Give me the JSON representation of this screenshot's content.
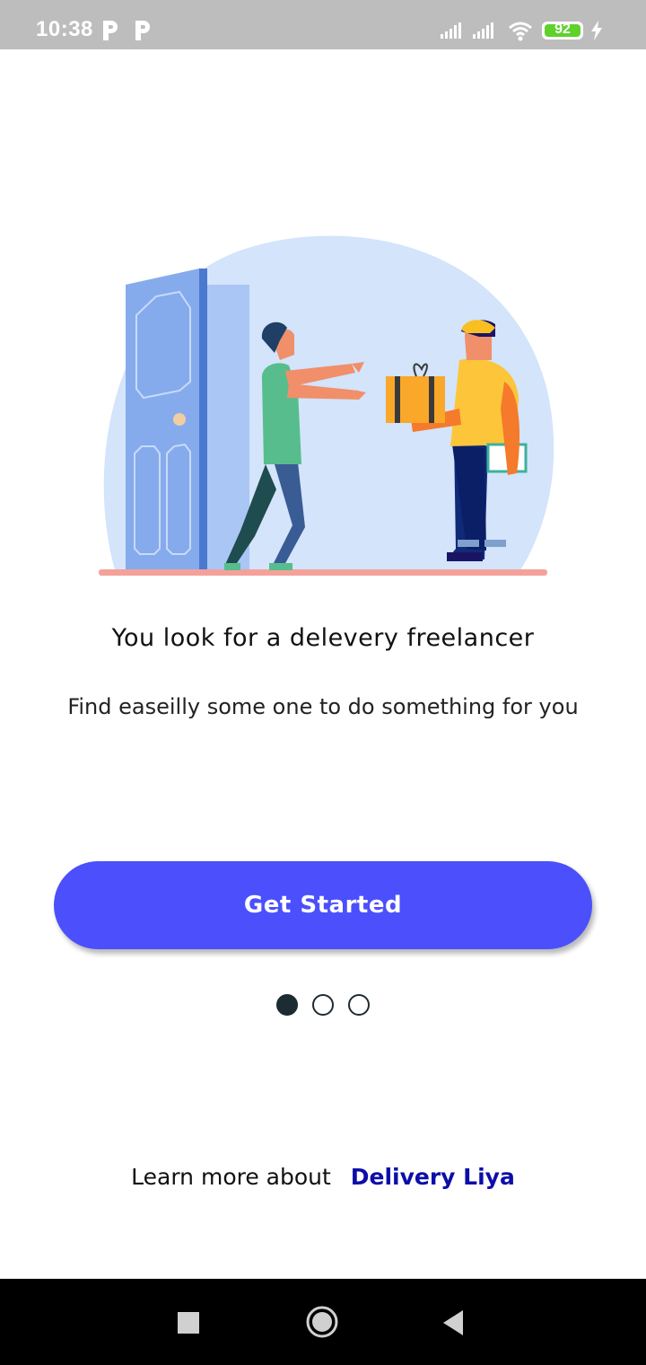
{
  "status_bar": {
    "time": "10:38",
    "battery": "92"
  },
  "onboarding": {
    "title": "You look for a delevery freelancer",
    "subtitle": "Find easeilly some one to do something for you",
    "cta_label": "Get Started",
    "page_count": 3,
    "active_page": 1
  },
  "footer": {
    "text": "Learn more about",
    "link": "Delivery Liya"
  },
  "colors": {
    "accent": "#4b50fc",
    "link": "#0d0ea8",
    "dot": "#1d2b33"
  },
  "icons": {
    "status": [
      "parking-notification-icon",
      "parking-notification-icon",
      "signal-icon",
      "signal-icon",
      "wifi-icon",
      "battery-icon",
      "charging-icon"
    ],
    "nav": [
      "recents-square-icon",
      "home-circle-icon",
      "back-triangle-icon"
    ]
  }
}
